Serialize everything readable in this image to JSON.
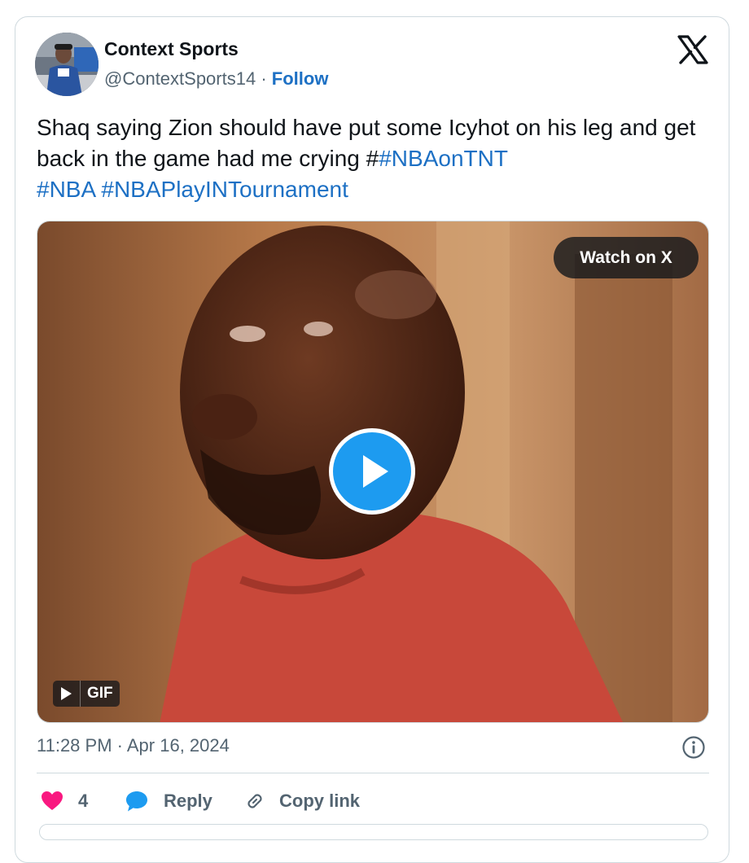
{
  "author": {
    "name": "Context Sports",
    "handle": "@ContextSports14",
    "separator": " · ",
    "follow_label": "Follow"
  },
  "tweet": {
    "text_prefix": "Shaq saying Zion should have put some Icyhot on his leg and get back in the game had me crying #",
    "hashtags": [
      "#NBAonTNT",
      "#NBA",
      "#NBAPlayINTournament"
    ]
  },
  "media": {
    "watch_label": "Watch on X",
    "badge_label": "GIF"
  },
  "meta": {
    "timestamp": "11:28 PM · Apr 16, 2024"
  },
  "actions": {
    "like_count": "4",
    "reply_label": "Reply",
    "copy_label": "Copy link"
  },
  "colors": {
    "link": "#1d70c4",
    "like": "#f91880",
    "reply_icon": "#1d9bf0",
    "play": "#1d9bf0",
    "muted": "#536471"
  },
  "icons": {
    "logo": "x-logo-icon",
    "play": "play-icon",
    "info": "info-icon",
    "like": "heart-icon",
    "reply": "speech-bubble-icon",
    "copy": "link-icon"
  }
}
